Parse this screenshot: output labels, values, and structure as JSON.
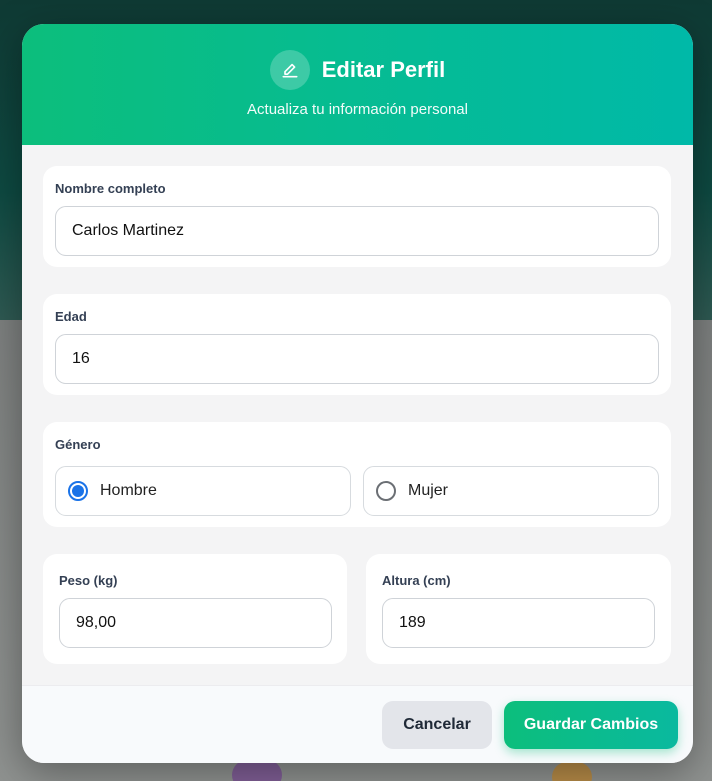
{
  "modal": {
    "title": "Editar Perfil",
    "subtitle": "Actualiza tu información personal",
    "title_icon": "pencil-edit-icon"
  },
  "form": {
    "name": {
      "label": "Nombre completo",
      "value": "Carlos Martinez"
    },
    "age": {
      "label": "Edad",
      "value": "16"
    },
    "gender": {
      "label": "Género",
      "options": [
        {
          "label": "Hombre",
          "checked": true
        },
        {
          "label": "Mujer",
          "checked": false
        }
      ]
    },
    "weight": {
      "label": "Peso (kg)",
      "value": "98,00"
    },
    "height": {
      "label": "Altura (cm)",
      "value": "189"
    }
  },
  "footer": {
    "cancel_label": "Cancelar",
    "save_label": "Guardar Cambios"
  },
  "colors": {
    "accent_start": "#0cbe7c",
    "accent_end": "#00b9a8",
    "radio_checked": "#1a73e8"
  }
}
